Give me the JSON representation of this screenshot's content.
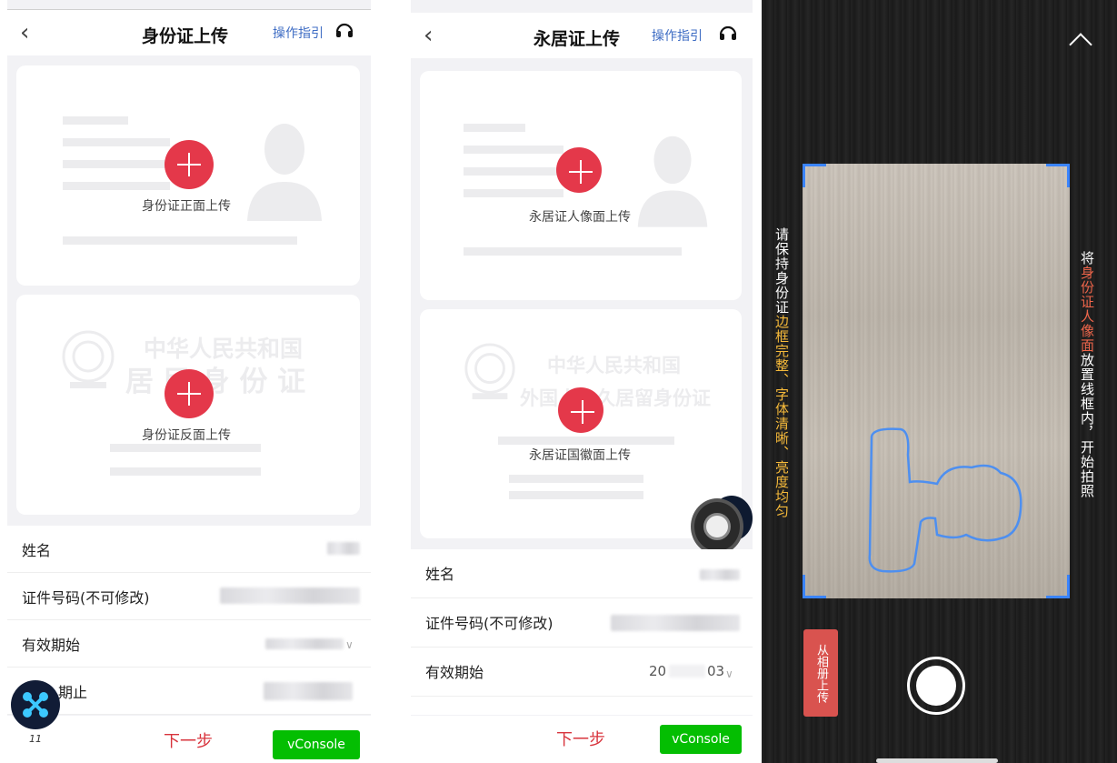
{
  "screen_id_card": {
    "title": "身份证上传",
    "guide_link": "操作指引",
    "front_label": "身份证正面上传",
    "back_label": "身份证反面上传",
    "watermark_line1": "中华人民共和国",
    "watermark_line2": "居 民 身 份 证",
    "fields": [
      {
        "label": "姓名"
      },
      {
        "label": "证件号码(不可修改)"
      },
      {
        "label": "有效期始"
      },
      {
        "label": "有效期止",
        "visible_label": "期止"
      }
    ],
    "next_label": "下一步",
    "vconsole_label": "vConsole",
    "version_text": "11"
  },
  "screen_permanent": {
    "title": "永居证上传",
    "guide_link": "操作指引",
    "front_label": "永居证人像面上传",
    "back_label": "永居证国徽面上传",
    "watermark_line1": "中华人民共和国",
    "watermark_line2": "外国人永久居留身份证",
    "fields": [
      {
        "label": "姓名"
      },
      {
        "label": "证件号码(不可修改)"
      },
      {
        "label": "有效期始",
        "value_start": "20",
        "value_end": "03"
      }
    ],
    "next_label": "下一步",
    "vconsole_label": "vConsole"
  },
  "screen_camera": {
    "left_instruction_prefix": "请保持身份证",
    "left_instruction_highlight": "边框完整、字体清晰、亮度均匀",
    "right_instruction_prefix": "将",
    "right_instruction_highlight": "身份证人像面",
    "right_instruction_suffix": "放置线框内，开始拍照",
    "album_button": "从相册上传"
  },
  "colors": {
    "accent_red": "#e4384a",
    "link_blue": "#3f6dc4",
    "vconsole_green": "#04be02",
    "frame_blue": "#3a84ff",
    "instruction_yellow": "#f5b93a"
  }
}
